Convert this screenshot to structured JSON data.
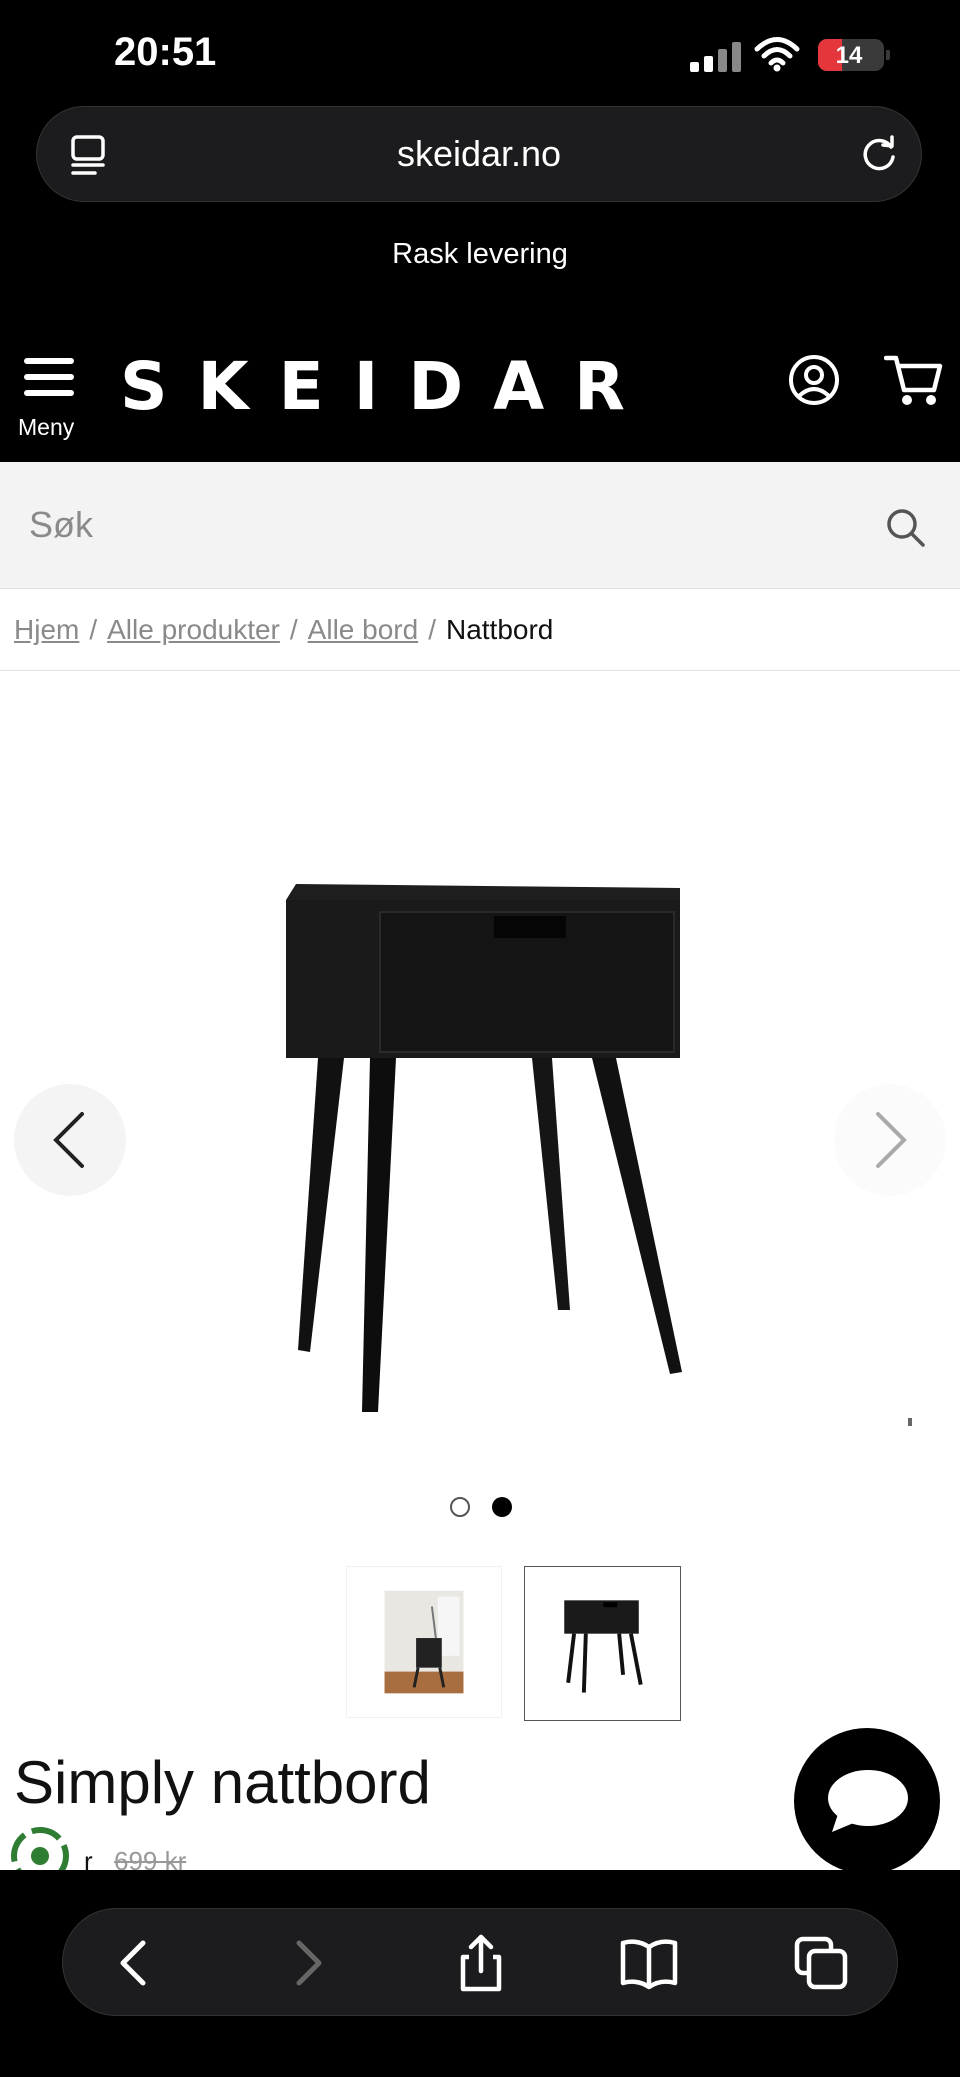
{
  "status_bar": {
    "time": "20:51",
    "battery": "14"
  },
  "browser": {
    "url": "skeidar.no"
  },
  "promo": {
    "text": "Rask levering"
  },
  "header": {
    "menu_label": "Meny",
    "logo": "SKEIDAR"
  },
  "search": {
    "placeholder": "Søk"
  },
  "breadcrumb": {
    "items": [
      "Hjem",
      "Alle produkter",
      "Alle bord"
    ],
    "current": "Nattbord",
    "separator": "/"
  },
  "gallery": {
    "slide_count": 2,
    "active_slide": 2
  },
  "product": {
    "title": "Simply nattbord",
    "price_prefix": "r",
    "old_price": "699 kr"
  },
  "colors": {
    "header_bg": "#000000",
    "search_bg": "#f3f3f3",
    "accent_green": "#2e7d32"
  }
}
